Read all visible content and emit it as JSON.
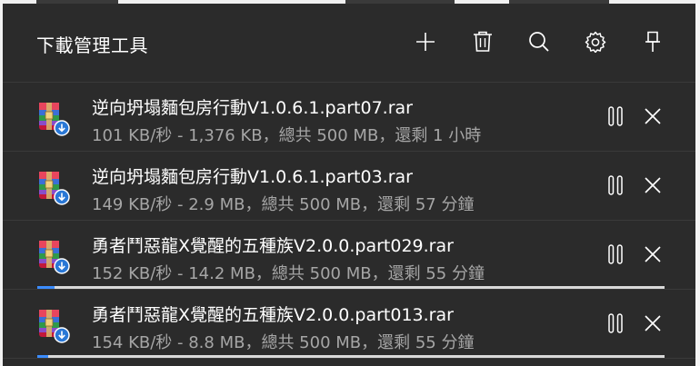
{
  "header": {
    "title": "下載管理工具",
    "buttons": [
      {
        "name": "add-button",
        "icon": "plus-icon"
      },
      {
        "name": "delete-button",
        "icon": "trash-icon"
      },
      {
        "name": "search-button",
        "icon": "search-icon"
      },
      {
        "name": "settings-button",
        "icon": "gear-icon"
      },
      {
        "name": "pin-button",
        "icon": "pin-icon"
      }
    ]
  },
  "downloads": [
    {
      "filename": "逆向坍塌麵包房行動V1.0.6.1.part07.rar",
      "status": "101 KB/秒 - 1,376 KB，總共 500 MB，還剩 1 小時",
      "progress_fraction": 0.0,
      "show_progress": false
    },
    {
      "filename": "逆向坍塌麵包房行動V1.0.6.1.part03.rar",
      "status": "149 KB/秒 - 2.9 MB，總共 500 MB，還剩 57 分鐘",
      "progress_fraction": 0.0,
      "show_progress": false
    },
    {
      "filename": "勇者鬥惡龍X覺醒的五種族V2.0.0.part029.rar",
      "status": "152 KB/秒 - 14.2 MB，總共 500 MB，還剩 55 分鐘",
      "progress_fraction": 0.028,
      "show_progress": true
    },
    {
      "filename": "勇者鬥惡龍X覺醒的五種族V2.0.0.part013.rar",
      "status": "154 KB/秒 - 8.8 MB，總共 500 MB，還剩 55 分鐘",
      "progress_fraction": 0.018,
      "show_progress": true
    }
  ],
  "colors": {
    "background": "#2b2b2b",
    "text_primary": "#ffffff",
    "text_secondary": "#a6a6a6",
    "progress_fill": "#3b8cff",
    "progress_track": "#d9d9d9"
  }
}
